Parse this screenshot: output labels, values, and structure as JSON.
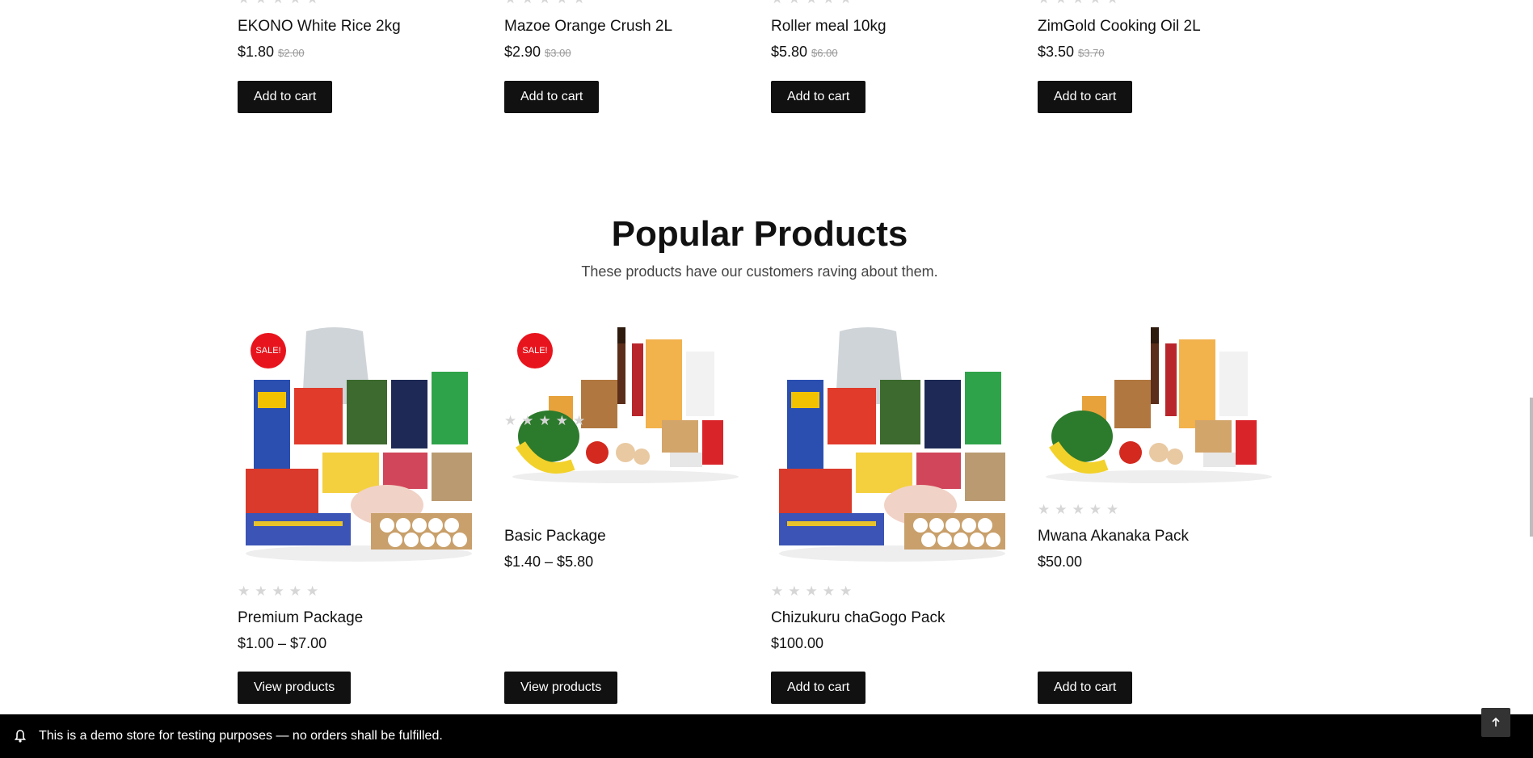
{
  "top_products": [
    {
      "title": "EKONO White Rice 2kg",
      "price": "$1.80",
      "old_price": "$2.00",
      "button": "Add to cart"
    },
    {
      "title": "Mazoe Orange Crush 2L",
      "price": "$2.90",
      "old_price": "$3.00",
      "button": "Add to cart"
    },
    {
      "title": "Roller meal 10kg",
      "price": "$5.80",
      "old_price": "$6.00",
      "button": "Add to cart"
    },
    {
      "title": "ZimGold Cooking Oil 2L",
      "price": "$3.50",
      "old_price": "$3.70",
      "button": "Add to cart"
    }
  ],
  "popular": {
    "title": "Popular Products",
    "subtitle": "These products have our customers raving about them.",
    "products": [
      {
        "title": "Premium Package",
        "price": "$1.00 – $7.00",
        "badge": "SALE!",
        "button": "View products",
        "image": "grocery-bundle-large"
      },
      {
        "title": "Basic Package",
        "price": "$1.40 – $5.80",
        "badge": "SALE!",
        "button": "View products",
        "image": "grocery-basket-small"
      },
      {
        "title": "Chizukuru chaGogo Pack",
        "price": "$100.00",
        "badge": "",
        "button": "Add to cart",
        "image": "grocery-bundle-large"
      },
      {
        "title": "Mwana Akanaka Pack",
        "price": "$50.00",
        "badge": "",
        "button": "Add to cart",
        "image": "grocery-basket-small"
      }
    ]
  },
  "notice": {
    "text": "This is a demo store for testing purposes — no orders shall be fulfilled.",
    "icon": "bell-icon"
  },
  "back_to_top": {
    "icon": "arrow-up-icon"
  },
  "colors": {
    "button_bg": "#111111",
    "sale_badge": "#e8141d",
    "notice_bg": "#000000",
    "star_empty": "#d6d6d6"
  }
}
